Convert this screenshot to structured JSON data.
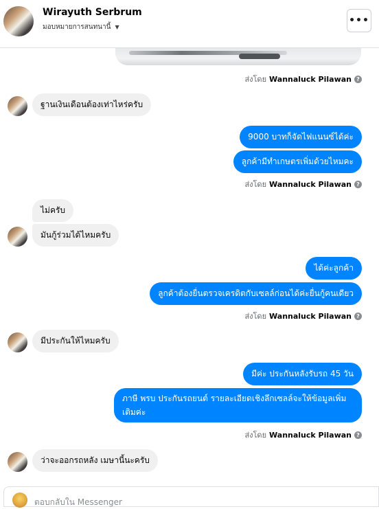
{
  "header": {
    "name": "Wirayuth Serbrum",
    "subtitle": "มอบหมายการสนทนานี้",
    "more_label": "•••"
  },
  "sent_by_prefix": "ส่งโดย",
  "agent_name": "Wannaluck Pilawan",
  "help_glyph": "?",
  "messages": [
    {
      "text": "ฐานเงินเดือนต้องเท่าไหร่ครับ"
    },
    {
      "text": "9000  บาทก็จัดไฟแนนซ์ได้ค่ะ"
    },
    {
      "text": "ลูกค้ามีทำเกษตรเพิ่มด้วยไหมคะ"
    },
    {
      "text": "ไม่ครับ"
    },
    {
      "text": "มันกู้ร่วมได้ไหมครับ"
    },
    {
      "text": "ได้ค่ะลูกค้า"
    },
    {
      "text": "ลูกค้าต้องยื่นตรวจเครดิตกับเซลล์ก่อนได้ค่ะยื่นกู้คนเดียว"
    },
    {
      "text": "มีประกันให้ไหมครับ"
    },
    {
      "text": "มีค่ะ  ประกันหลังรับรถ 45 วัน"
    },
    {
      "text": "ภาษี  พรบ  ประกันรถยนต์  รายละเอียดเชิงลึกเซลล์จะให้ข้อมูลเพิ่มเติมค่ะ"
    },
    {
      "text": "ว่าจะออกรถหลัง  เมษานี้นะครับ"
    }
  ],
  "composer": {
    "placeholder": "ตอบกลับใน Messenger"
  },
  "colors": {
    "outgoing": "#0084ff",
    "incoming": "#f0f0f0"
  }
}
